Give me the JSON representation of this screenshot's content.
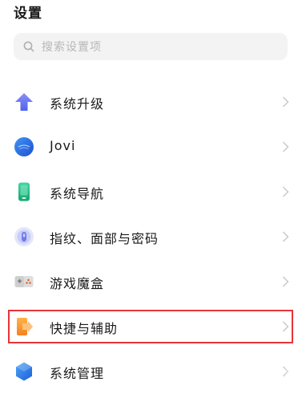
{
  "header": {
    "title": "设置"
  },
  "search": {
    "placeholder": "搜索设置项",
    "icon": "search-icon"
  },
  "menu": {
    "items": [
      {
        "label": "系统升级",
        "icon": "system-update-icon",
        "color": "#5b6cf5"
      },
      {
        "label": "Jovi",
        "icon": "jovi-icon",
        "color": "#2b7be8"
      },
      {
        "label": "系统导航",
        "icon": "system-navigation-icon",
        "color": "#23c18a"
      },
      {
        "label": "指纹、面部与密码",
        "icon": "fingerprint-icon",
        "color": "#7b86f0"
      },
      {
        "label": "游戏魔盒",
        "icon": "game-box-icon",
        "color": "#e9683a"
      },
      {
        "label": "快捷与辅助",
        "icon": "shortcut-assist-icon",
        "color": "#f59a2c"
      },
      {
        "label": "系统管理",
        "icon": "system-management-icon",
        "color": "#2f7de6"
      }
    ]
  },
  "highlight_color": "#e5353a"
}
